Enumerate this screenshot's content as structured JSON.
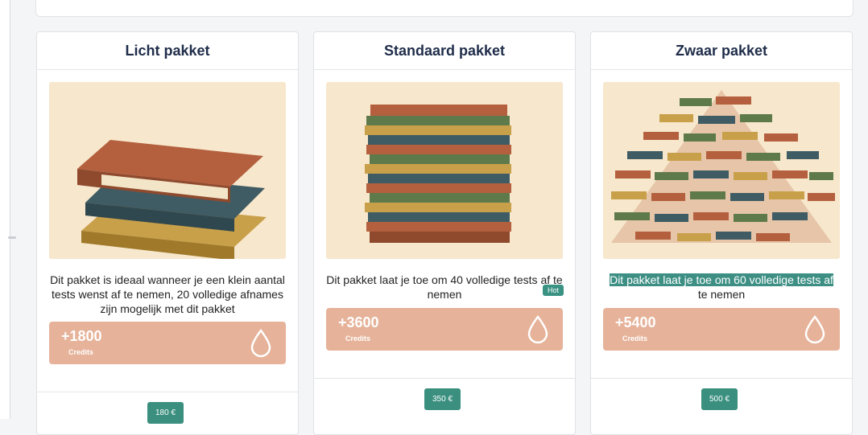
{
  "colors": {
    "credits_bg": "#e6b299",
    "button_bg": "#3a8f7f",
    "highlight_bg": "#3d8f84",
    "title": "#1f2d4a"
  },
  "packages": [
    {
      "title": "Licht pakket",
      "description": "Dit pakket is ideaal wanneer je een klein aantal tests wenst af te nemen, 20 volledige afnames zijn mogelijk met dit pakket",
      "credits": "+1800",
      "credits_label": "Credits",
      "price": "180 €",
      "icon": "drop-icon"
    },
    {
      "title": "Standaard pakket",
      "description": "Dit pakket laat je toe om 40 volledige tests af te nemen",
      "badge": "Hot",
      "credits": "+3600",
      "credits_label": "Credits",
      "price": "350 €",
      "icon": "drop-icon"
    },
    {
      "title": "Zwaar pakket",
      "description_highlight": "Dit pakket laat je toe om 60 volledige tests af",
      "description_rest": "te nemen",
      "credits": "+5400",
      "credits_label": "Credits",
      "price": "500 €",
      "icon": "drop-icon"
    }
  ]
}
